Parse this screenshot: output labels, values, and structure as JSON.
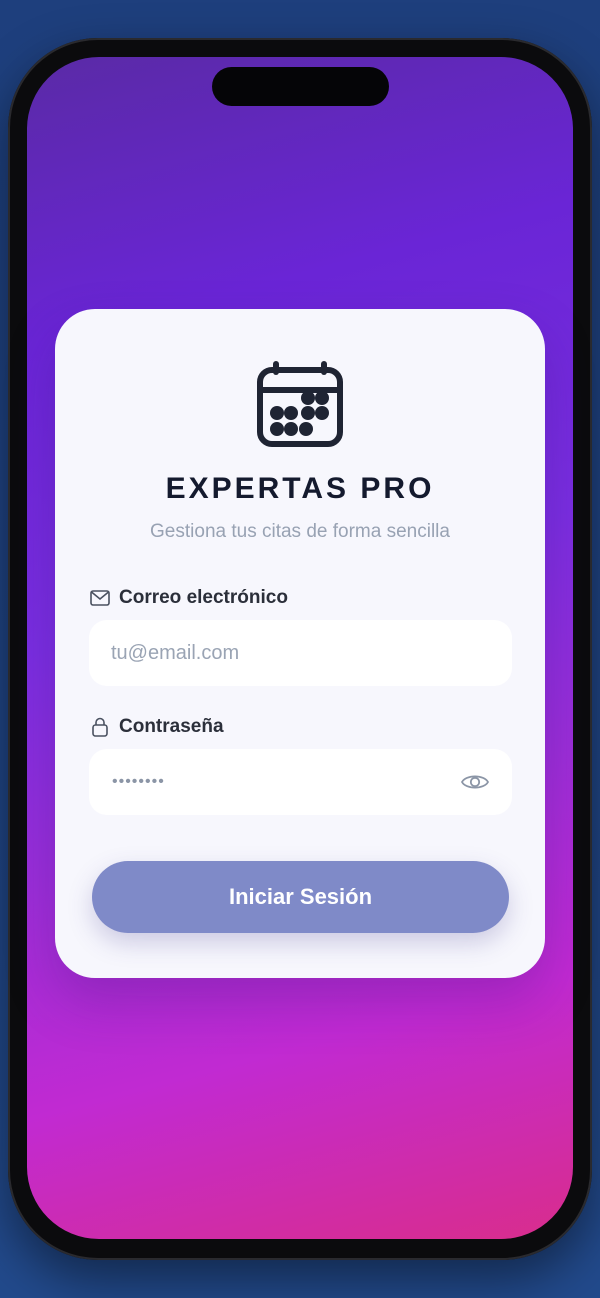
{
  "app": {
    "title": "EXPERTAS PRO",
    "subtitle": "Gestiona tus citas de forma sencilla",
    "logo_icon": "calendar-icon"
  },
  "form": {
    "email": {
      "label": "Correo electrónico",
      "placeholder": "tu@email.com",
      "value": "",
      "icon": "mail-icon"
    },
    "password": {
      "label": "Contraseña",
      "masked_value": "••••••••",
      "icon": "lock-icon",
      "toggle_icon": "eye-icon"
    },
    "submit_label": "Iniciar Sesión"
  },
  "colors": {
    "card_bg": "#f7f7fd",
    "button_bg": "#7f8ac8",
    "title_text": "#141a2e",
    "subtitle_text": "#98a2b3",
    "gradient_top": "#5a2aa6",
    "gradient_bottom": "#d92d8c"
  }
}
